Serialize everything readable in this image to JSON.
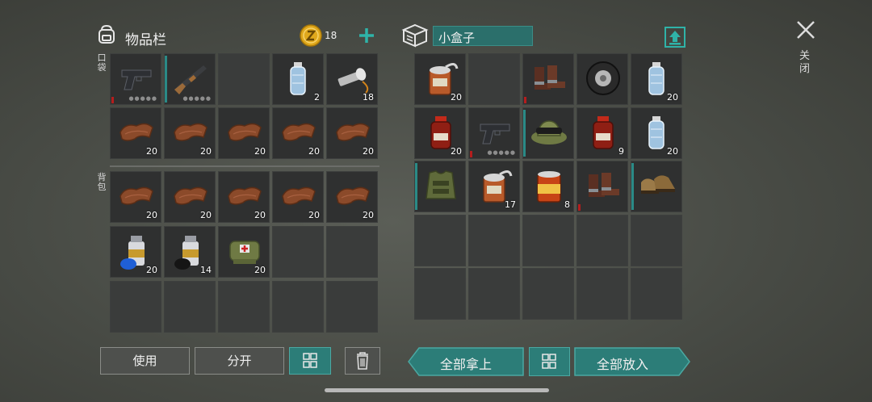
{
  "inventory": {
    "title": "物品栏",
    "coin_count": "18",
    "pocket_label": "口袋",
    "backpack_label": "背包",
    "slots": [
      {
        "icon": "pistol-icon",
        "qty": "",
        "tag": "red",
        "dots": true
      },
      {
        "icon": "shotgun-icon",
        "qty": "",
        "tag": "teal",
        "dots": true
      },
      {
        "icon": "",
        "qty": ""
      },
      {
        "icon": "water-bottle-icon",
        "qty": "2"
      },
      {
        "icon": "flashlight-icon",
        "qty": "18"
      },
      {
        "icon": "leather-icon",
        "qty": "20"
      },
      {
        "icon": "leather-icon",
        "qty": "20"
      },
      {
        "icon": "leather-icon",
        "qty": "20"
      },
      {
        "icon": "leather-icon",
        "qty": "20"
      },
      {
        "icon": "leather-icon",
        "qty": "20"
      },
      {
        "icon": "leather-icon",
        "qty": "20"
      },
      {
        "icon": "leather-icon",
        "qty": "20"
      },
      {
        "icon": "leather-icon",
        "qty": "20"
      },
      {
        "icon": "leather-icon",
        "qty": "20"
      },
      {
        "icon": "leather-icon",
        "qty": "20"
      },
      {
        "icon": "blue-spray-can-icon",
        "qty": "20"
      },
      {
        "icon": "black-spray-can-icon",
        "qty": "14"
      },
      {
        "icon": "first-aid-bag-icon",
        "qty": "20"
      },
      {
        "icon": "",
        "qty": ""
      },
      {
        "icon": "",
        "qty": ""
      },
      {
        "icon": "",
        "qty": ""
      },
      {
        "icon": "",
        "qty": ""
      },
      {
        "icon": "",
        "qty": ""
      },
      {
        "icon": "",
        "qty": ""
      },
      {
        "icon": "",
        "qty": ""
      }
    ]
  },
  "container": {
    "title": "小盒子",
    "slots": [
      {
        "icon": "open-can-icon",
        "qty": "20"
      },
      {
        "icon": "",
        "qty": ""
      },
      {
        "icon": "boots-icon",
        "qty": "",
        "tag": "red"
      },
      {
        "icon": "tire-icon",
        "qty": ""
      },
      {
        "icon": "water-bottle-icon",
        "qty": "20"
      },
      {
        "icon": "sauce-jar-icon",
        "qty": "20"
      },
      {
        "icon": "pistol-icon",
        "qty": "",
        "tag": "red",
        "dots": true
      },
      {
        "icon": "camo-hat-icon",
        "qty": "",
        "tag": "teal"
      },
      {
        "icon": "sauce-jar-icon",
        "qty": "9"
      },
      {
        "icon": "water-bottle-icon",
        "qty": "20"
      },
      {
        "icon": "body-armor-icon",
        "qty": "",
        "tag": "teal"
      },
      {
        "icon": "open-can-icon",
        "qty": "17"
      },
      {
        "icon": "food-can-icon",
        "qty": "8"
      },
      {
        "icon": "boots-icon",
        "qty": "",
        "tag": "red"
      },
      {
        "icon": "tan-boots-icon",
        "qty": "",
        "tag": "teal"
      }
    ]
  },
  "buttons": {
    "use": "使用",
    "split": "分开",
    "take_all": "全部拿上",
    "put_all": "全部放入",
    "close": "关闭"
  },
  "colors": {
    "accent": "#2c7d78",
    "coin": "#e0a81c",
    "warning": "#b51d1d"
  }
}
